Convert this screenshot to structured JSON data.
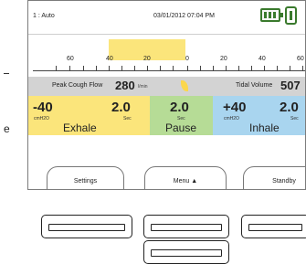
{
  "bleed": {
    "e_letter": "e"
  },
  "status": {
    "mode": "1 : Auto",
    "datetime": "03/01/2012 07:04 PM"
  },
  "scale": {
    "labels": [
      "60",
      "40",
      "20",
      "0",
      "20",
      "40",
      "60"
    ]
  },
  "flow": {
    "peak_label": "Peak Cough Flow",
    "peak_value": "280",
    "peak_unit": "l/min",
    "tidal_label": "Tidal Volume",
    "tidal_value": "507"
  },
  "phases": {
    "exhale": {
      "pressure": "-40",
      "pressure_unit": "cmH2O",
      "time": "2.0",
      "time_unit": "Sec",
      "label": "Exhale",
      "color": "#fbe57b"
    },
    "pause": {
      "time": "2.0",
      "time_unit": "Sec",
      "label": "Pause",
      "color": "#b6dc96"
    },
    "inhale": {
      "pressure": "+40",
      "pressure_unit": "cmH2O",
      "time": "2.0",
      "time_unit": "Sec",
      "label": "Inhale",
      "color": "#a9d5ef"
    }
  },
  "softkeys": {
    "settings": "Settings",
    "menu": "Menu ▲",
    "standby": "Standby"
  },
  "icons": {
    "battery": "battery-icon",
    "ac_power": "ac-power-icon"
  },
  "hardware_buttons": [
    "hw-key-left",
    "hw-key-center",
    "hw-key-right",
    "hw-key-center-lower"
  ]
}
